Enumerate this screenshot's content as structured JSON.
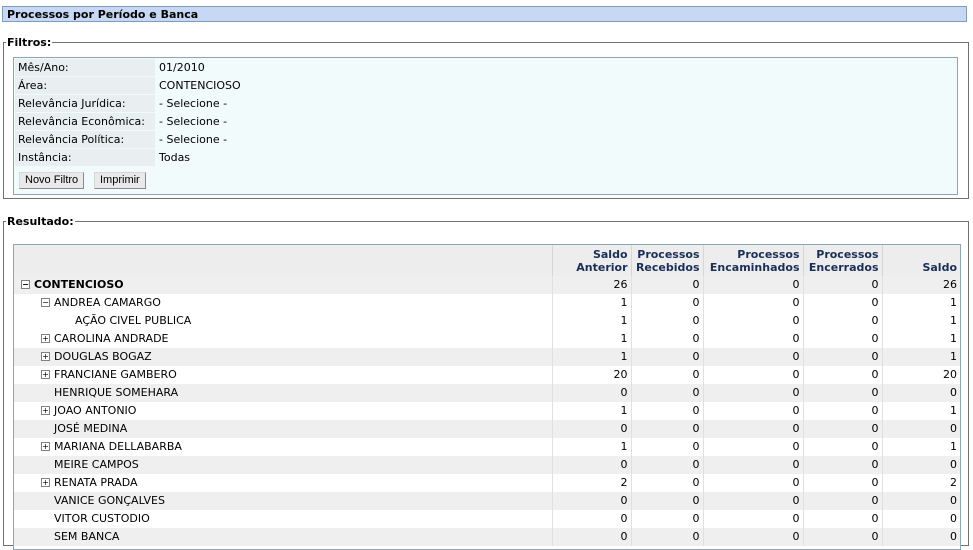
{
  "page": {
    "title": "Processos por Período e Banca"
  },
  "filters": {
    "legend": "Filtros:",
    "rows": [
      {
        "label": "Mês/Ano:",
        "value": "01/2010"
      },
      {
        "label": "Área:",
        "value": "CONTENCIOSO"
      },
      {
        "label": "Relevância Jurídica:",
        "value": "- Selecione -"
      },
      {
        "label": "Relevância Econômica:",
        "value": "- Selecione -"
      },
      {
        "label": "Relevância Política:",
        "value": "- Selecione -"
      },
      {
        "label": "Instância:",
        "value": "Todas"
      }
    ],
    "buttons": {
      "new_filter": "Novo Filtro",
      "print": "Imprimir"
    }
  },
  "results": {
    "legend": "Resultado:",
    "columns": [
      {
        "line1": "",
        "line2": ""
      },
      {
        "line1": "Saldo",
        "line2": "Anterior"
      },
      {
        "line1": "Processos",
        "line2": "Recebidos"
      },
      {
        "line1": "Processos",
        "line2": "Encaminhados"
      },
      {
        "line1": "Processos",
        "line2": "Encerrados"
      },
      {
        "line1": "",
        "line2": "Saldo"
      }
    ],
    "rows": [
      {
        "name": "CONTENCIOSO",
        "level": 0,
        "toggle": "−",
        "values": [
          "26",
          "0",
          "0",
          "0",
          "26"
        ]
      },
      {
        "name": "ANDREA CAMARGO",
        "level": 1,
        "toggle": "−",
        "values": [
          "1",
          "0",
          "0",
          "0",
          "1"
        ]
      },
      {
        "name": "AÇÃO CIVEL PUBLICA",
        "level": 2,
        "toggle": "",
        "values": [
          "1",
          "0",
          "0",
          "0",
          "1"
        ]
      },
      {
        "name": "CAROLINA ANDRADE",
        "level": 1,
        "toggle": "+",
        "values": [
          "1",
          "0",
          "0",
          "0",
          "1"
        ]
      },
      {
        "name": "DOUGLAS BOGAZ",
        "level": 1,
        "toggle": "+",
        "values": [
          "1",
          "0",
          "0",
          "0",
          "1"
        ]
      },
      {
        "name": "FRANCIANE GAMBERO",
        "level": 1,
        "toggle": "+",
        "values": [
          "20",
          "0",
          "0",
          "0",
          "20"
        ]
      },
      {
        "name": "HENRIQUE SOMEHARA",
        "level": 1,
        "toggle": "",
        "values": [
          "0",
          "0",
          "0",
          "0",
          "0"
        ]
      },
      {
        "name": "JOAO ANTONIO",
        "level": 1,
        "toggle": "+",
        "values": [
          "1",
          "0",
          "0",
          "0",
          "1"
        ]
      },
      {
        "name": "JOSÉ MEDINA",
        "level": 1,
        "toggle": "",
        "values": [
          "0",
          "0",
          "0",
          "0",
          "0"
        ]
      },
      {
        "name": "MARIANA DELLABARBA",
        "level": 1,
        "toggle": "+",
        "values": [
          "1",
          "0",
          "0",
          "0",
          "1"
        ]
      },
      {
        "name": "MEIRE CAMPOS",
        "level": 1,
        "toggle": "",
        "values": [
          "0",
          "0",
          "0",
          "0",
          "0"
        ]
      },
      {
        "name": "RENATA PRADA",
        "level": 1,
        "toggle": "+",
        "values": [
          "2",
          "0",
          "0",
          "0",
          "2"
        ]
      },
      {
        "name": "VANICE GONÇALVES",
        "level": 1,
        "toggle": "",
        "values": [
          "0",
          "0",
          "0",
          "0",
          "0"
        ]
      },
      {
        "name": "VITOR CUSTODIO",
        "level": 1,
        "toggle": "",
        "values": [
          "0",
          "0",
          "0",
          "0",
          "0"
        ]
      },
      {
        "name": "SEM BANCA",
        "level": 1,
        "toggle": "",
        "values": [
          "0",
          "0",
          "0",
          "0",
          "0"
        ]
      }
    ]
  },
  "colors": {
    "title_bg": "#c6d8f3",
    "header_text": "#1a2f57",
    "filter_bg": "#f1fbfb"
  }
}
